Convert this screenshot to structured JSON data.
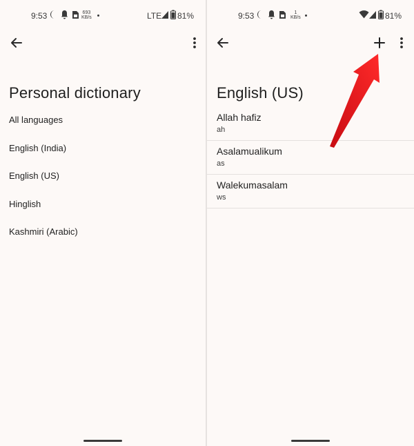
{
  "left_screen": {
    "status": {
      "time": "9:53",
      "speed_value": "693",
      "speed_unit": "KB/s",
      "network": "LTE",
      "battery": "81%"
    },
    "title": "Personal dictionary",
    "languages": [
      "All languages",
      "English (India)",
      "English (US)",
      "Hinglish",
      "Kashmiri (Arabic)"
    ]
  },
  "right_screen": {
    "status": {
      "time": "9:53",
      "speed_value": "1",
      "speed_unit": "KB/s",
      "battery": "81%"
    },
    "title": "English (US)",
    "entries": [
      {
        "word": "Allah hafiz",
        "shortcut": "ah"
      },
      {
        "word": "Asalamualikum",
        "shortcut": "as"
      },
      {
        "word": "Walekumasalam",
        "shortcut": "ws"
      }
    ]
  },
  "colors": {
    "background": "#fdf9f7",
    "annotation_arrow": "#e8111a",
    "text": "#1f1f1f"
  },
  "icons": [
    "back-arrow-icon",
    "more-vert-icon",
    "add-icon",
    "moon-icon",
    "bell-icon",
    "sim-icon",
    "signal-icon",
    "wifi-icon",
    "battery-icon"
  ]
}
